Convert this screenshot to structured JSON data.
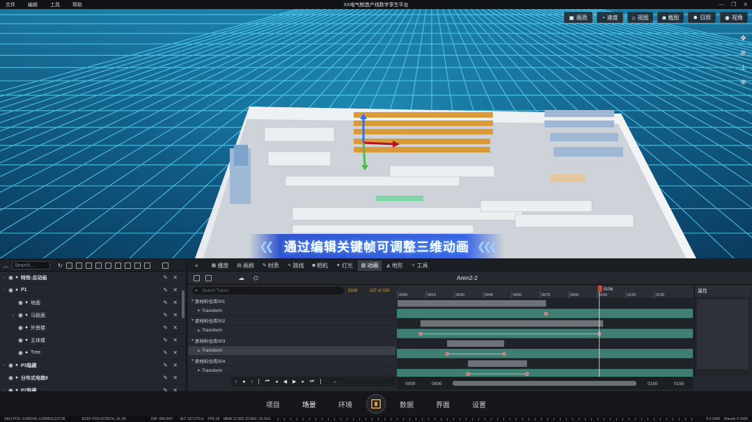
{
  "titlebar": {
    "menu": [
      "文件",
      "编辑",
      "工具",
      "帮助"
    ],
    "title": "XX电气制造产线数字孪生平台"
  },
  "view_toolbar": [
    {
      "icon": "image-icon",
      "label": "画质"
    },
    {
      "icon": "speed-icon",
      "label": "速度"
    },
    {
      "icon": "camera-icon",
      "label": "视图"
    },
    {
      "icon": "screenshot-icon",
      "label": "截图"
    },
    {
      "icon": "sun-icon",
      "label": "日照"
    },
    {
      "icon": "eye-icon",
      "label": "视角"
    }
  ],
  "caption": "通过编辑关键帧可调整三维动画",
  "outliner": {
    "search_placeholder": "Search...",
    "rows": [
      {
        "label": "特效-总动画",
        "depth": 0,
        "caret": true
      },
      {
        "label": "P1",
        "depth": 0,
        "caret": true
      },
      {
        "label": "地面",
        "depth": 1,
        "caret": false
      },
      {
        "label": "马路面",
        "depth": 1,
        "caret": true
      },
      {
        "label": "外景楼",
        "depth": 1,
        "caret": false
      },
      {
        "label": "主体楼",
        "depth": 1,
        "caret": false
      },
      {
        "label": "Tree",
        "depth": 1,
        "caret": false
      },
      {
        "label": "P3隐藏",
        "depth": 0,
        "caret": true
      },
      {
        "label": "分布式电箱9",
        "depth": 0,
        "caret": false
      },
      {
        "label": "P2隐藏",
        "depth": 0,
        "caret": true
      }
    ]
  },
  "timeline": {
    "tabs": [
      {
        "icon": "film-icon",
        "label": "播放"
      },
      {
        "icon": "brush-icon",
        "label": "画刷"
      },
      {
        "icon": "material-icon",
        "label": "材质"
      },
      {
        "icon": "path-icon",
        "label": "路线"
      },
      {
        "icon": "camera-icon",
        "label": "相机"
      },
      {
        "icon": "light-icon",
        "label": "灯光"
      },
      {
        "icon": "animation-icon",
        "label": "动画"
      },
      {
        "icon": "terrain-icon",
        "label": "地形"
      },
      {
        "icon": "tool-icon",
        "label": "工具"
      }
    ],
    "active_tab": "动画",
    "anim_name": "Anim2-2",
    "search_placeholder": "Search Tracks",
    "frame_now": "0106",
    "frame_total": "107 of 150",
    "tracks": [
      {
        "label": "原材料仓库001",
        "type": "group"
      },
      {
        "label": "Transform",
        "type": "child"
      },
      {
        "label": "原材料仓库002",
        "type": "group"
      },
      {
        "label": "Transform",
        "type": "child"
      },
      {
        "label": "原材料仓库003",
        "type": "group"
      },
      {
        "label": "Transform",
        "type": "child",
        "selected": true
      },
      {
        "label": "原材料仓库004",
        "type": "group"
      },
      {
        "label": "Transform",
        "type": "child"
      }
    ],
    "ruler_ticks": [
      "0000",
      "0015",
      "0030",
      "0045",
      "0060",
      "0075",
      "0090",
      "0105",
      "0120",
      "0135"
    ],
    "playhead": "0106",
    "range_start_a": "0000",
    "range_start_b": "0000",
    "range_end_a": "0150",
    "range_end_b": "0150",
    "props_title": "属性"
  },
  "bottom_nav": [
    "项目",
    "场景",
    "环境",
    "数据",
    "界面",
    "设置"
  ],
  "bottom_nav_active": "场景",
  "statusbar": {
    "geo": "GEO POS  -0.000140,-0.000503,137.09",
    "ecef": "ECEF POS  6378274,-15,-55",
    "dir": "DIR  -090.600°",
    "alt": "ALT  137.079 m",
    "fps": "FPS  18",
    "mem": "MEM  12.05G  23.58G / 31.91G",
    "version": "5.6.2969",
    "copyright": "Piaoshi © 2025"
  }
}
